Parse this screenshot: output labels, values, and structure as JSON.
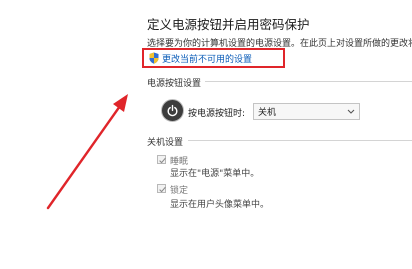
{
  "header": {
    "title": "定义电源按钮并启用密码保护",
    "subtitle": "选择要为你的计算机设置的电源设置。在此页上对设置所做的更改将应"
  },
  "change_link": {
    "label": "更改当前不可用的设置",
    "icon": "uac-shield-icon"
  },
  "power_button_section": {
    "heading": "电源按钮设置",
    "row_label": "按电源按钮时:",
    "select_value": "关机",
    "icon": "power-icon"
  },
  "shutdown_section": {
    "heading": "关机设置",
    "options": [
      {
        "label": "睡眠",
        "description": "显示在\"电源\"菜单中。",
        "checked": true
      },
      {
        "label": "锁定",
        "description": "显示在用户头像菜单中。",
        "checked": true
      }
    ]
  },
  "annotation": {
    "arrow_color": "#e0252a",
    "highlight_color": "#e0252a"
  }
}
